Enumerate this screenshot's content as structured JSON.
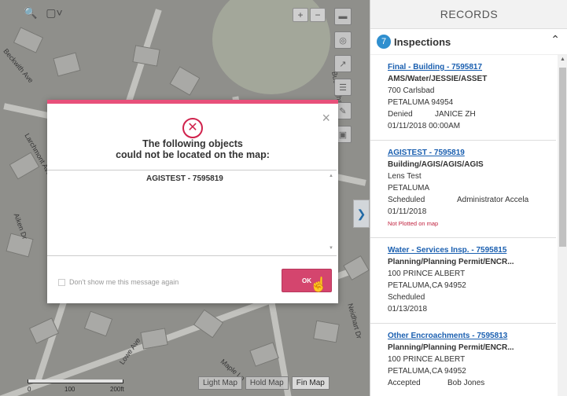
{
  "map": {
    "street_labels": [
      "Larchmont Ave",
      "Aiken Dr",
      "Lowe Ave",
      "Beckwith Ave",
      "Maple Ln",
      "Neidhart Dr",
      "Buckingham Dr"
    ],
    "scale": {
      "start": "0",
      "mid": "100",
      "end": "200ft"
    },
    "basemaps": {
      "light": "Light Map",
      "mid": "Hold Map",
      "active": "Fin Map"
    },
    "zoom": {
      "in": "+",
      "out": "−"
    }
  },
  "dialog": {
    "message_line1": "The following objects",
    "message_line2": "could not be located on the map:",
    "items": [
      "AGISTEST - 7595819"
    ],
    "dont_show": "Don't show me this message again",
    "ok_label": "OK",
    "close": "×",
    "accent_color": "#e8507a"
  },
  "records": {
    "header": "RECORDS",
    "count": "7",
    "section_title": "Inspections",
    "items": [
      {
        "link": "Final - Building - 7595817",
        "type": "AMS/Water/JESSIE/ASSET",
        "address": "700 Carlsbad",
        "city": "PETALUMA 94954",
        "status": "Denied",
        "assignee": "JANICE ZH",
        "date": "01/11/2018 00:00AM",
        "note": ""
      },
      {
        "link": "AGISTEST - 7595819",
        "type": "Building/AGIS/AGIS/AGIS",
        "address": "Lens Test",
        "city": "PETALUMA",
        "status": "Scheduled",
        "assignee": "Administrator Accela",
        "date": "01/11/2018",
        "note": "Not Plotted on map"
      },
      {
        "link": "Water - Services Insp. - 7595815",
        "type": "Planning/Planning Permit/ENCR...",
        "address": "100 PRINCE ALBERT",
        "city": "PETALUMA,CA 94952",
        "status": "Scheduled",
        "assignee": "",
        "date": "01/13/2018",
        "note": ""
      },
      {
        "link": "Other Encroachments - 7595813",
        "type": "Planning/Planning Permit/ENCR...",
        "address": "100 PRINCE ALBERT",
        "city": "PETALUMA,CA 94952",
        "status": "Accepted",
        "assignee": "Bob Jones",
        "date": "",
        "note": ""
      }
    ]
  }
}
